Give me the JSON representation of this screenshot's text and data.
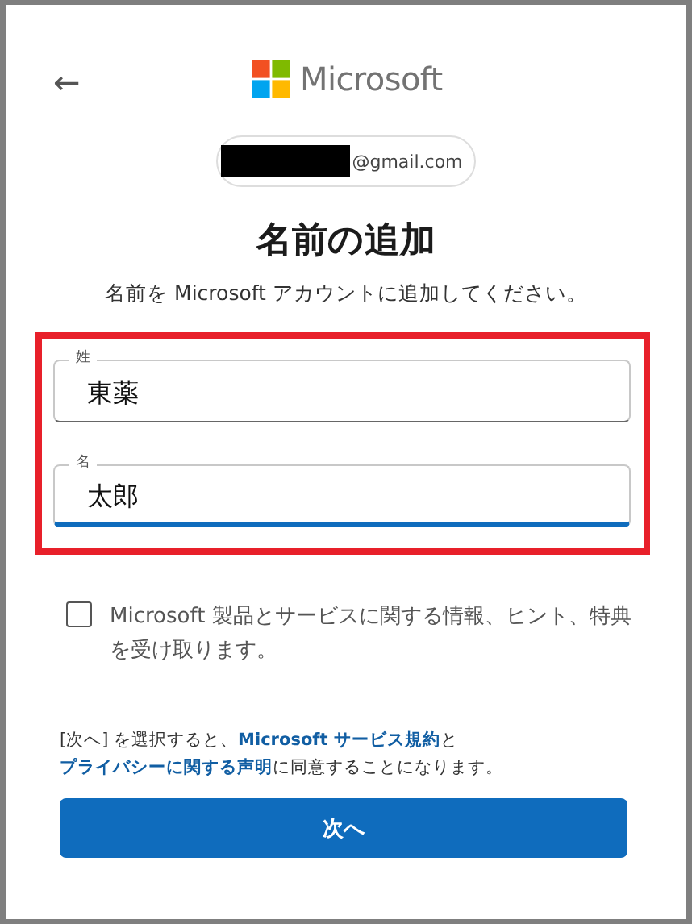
{
  "header": {
    "back": "←",
    "brand": "Microsoft"
  },
  "account": {
    "email_suffix": "@gmail.com",
    "redacted": true
  },
  "title": "名前の追加",
  "subtitle": "名前を Microsoft アカウントに追加してください。",
  "fields": [
    {
      "label": "姓",
      "value": "東薬",
      "focused": false
    },
    {
      "label": "名",
      "value": "太郎",
      "focused": true
    }
  ],
  "highlight": true,
  "consent": {
    "label": "Microsoft 製品とサービスに関する情報、ヒント、特典を受け取ります。",
    "checked": false
  },
  "legal": [
    {
      "kind": "text",
      "text": "[次へ] を選択すると、"
    },
    {
      "kind": "link",
      "text": "Microsoft サービス規約"
    },
    {
      "kind": "text",
      "text": "と"
    },
    {
      "kind": "link",
      "text": "プライバシーに関する声明"
    },
    {
      "kind": "text",
      "text": "に同意することになります。"
    }
  ],
  "button": "次へ"
}
